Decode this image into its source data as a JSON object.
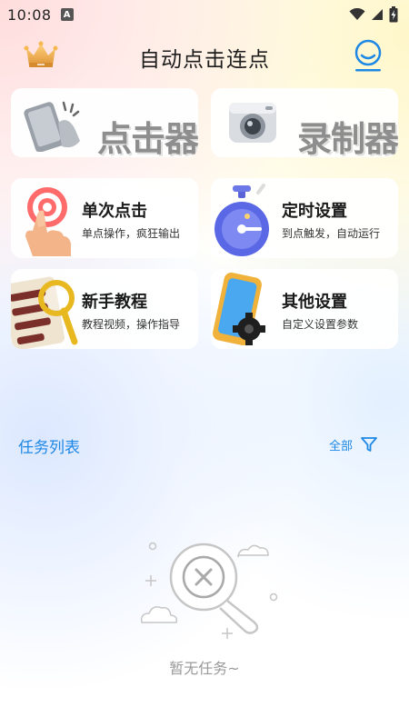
{
  "status_bar": {
    "time": "10:08",
    "notification_icon": "a-icon",
    "icons": [
      "wifi-icon",
      "signal-icon",
      "battery-charging-icon"
    ]
  },
  "header": {
    "title": "自动点击连点",
    "left_icon": "crown-icon",
    "right_icon": "profile-icon"
  },
  "big_cards": [
    {
      "label": "点击器",
      "icon": "phone-tap-icon"
    },
    {
      "label": "录制器",
      "icon": "camera-icon"
    }
  ],
  "feature_cards": [
    {
      "title": "单次点击",
      "subtitle": "单点操作，疯狂输出",
      "icon": "finger-target-icon"
    },
    {
      "title": "定时设置",
      "subtitle": "到点触发，自动运行",
      "icon": "stopwatch-icon"
    },
    {
      "title": "新手教程",
      "subtitle": "教程视频，操作指导",
      "icon": "magnifier-book-icon"
    },
    {
      "title": "其他设置",
      "subtitle": "自定义设置参数",
      "icon": "phone-gear-icon"
    }
  ],
  "tasks": {
    "title": "任务列表",
    "filter_label": "全部",
    "filter_icon": "filter-icon",
    "empty_icon": "empty-search-icon",
    "empty_text": "暂无任务~"
  },
  "colors": {
    "accent": "#1e88e5",
    "empty_text": "#9a9a9a"
  }
}
